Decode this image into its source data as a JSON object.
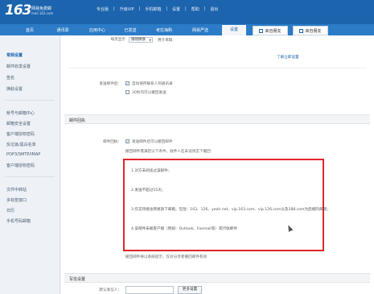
{
  "header": {
    "logo_number": "163",
    "logo_text": "网易免费邮",
    "logo_domain": "mail.163.com",
    "nav": [
      "专业版",
      "升级VIP",
      "手机邮箱",
      "设置",
      "帮助",
      "退出"
    ]
  },
  "tabs": [
    "首页",
    "通讯录",
    "应用中心",
    "已发送",
    "考拉海购",
    "网易严选",
    "设置",
    "来自朋友",
    "来自朋友"
  ],
  "sidebar": {
    "items": [
      "常规设置",
      "邮件收发设置",
      "签名",
      "换肤设置",
      "帐号与邮箱中心",
      "邮箱安全设置",
      "客户端授权密码",
      "反垃圾/黑白名单",
      "POP3/SMTP/IMAP",
      "客户端授权密码",
      "文件中转站",
      "多标签窗口",
      "日历",
      "手机号码邮箱"
    ]
  },
  "settings": {
    "auto_save_label": "发送邮件后：",
    "auto_save_option": "自动保存联系人到通讯录",
    "delay_option": "30秒内可以撤回发送",
    "select_value": "跟随换肤",
    "top_note": "每页显示",
    "top_note2": "用于草稿",
    "link_text": "了解立即设置"
  },
  "section": {
    "title": "邮件回执",
    "row_label": "邮件回执：",
    "checkbox_text": "发送邮件后可以撤回邮件",
    "desc": "撤回邮件需满足以下条件，收件人在未读状态下撤回",
    "red_lines": [
      "1.对方未阅读过该邮件；",
      "2.发送不超过15天；",
      "3.仅支持发往网易旗下邮箱，包括：163、126、yeah.net、vip.163.com、vip.126.com以及188.com为后缀的邮箱；",
      "4.该邮件未被客户端（例如：Outlook、Foxmail等）或代收邮件"
    ],
    "bottom_note": "撤回邮件将以系统提示，仅对分享者撤回邮件有效"
  },
  "section2": {
    "title": "写信设置",
    "row_label": "默认发信人：",
    "button": "更多设置"
  },
  "colors": {
    "topbar": "#1c64ad",
    "tabbar": "#2b7bc7",
    "highlight": "#e0262a"
  }
}
